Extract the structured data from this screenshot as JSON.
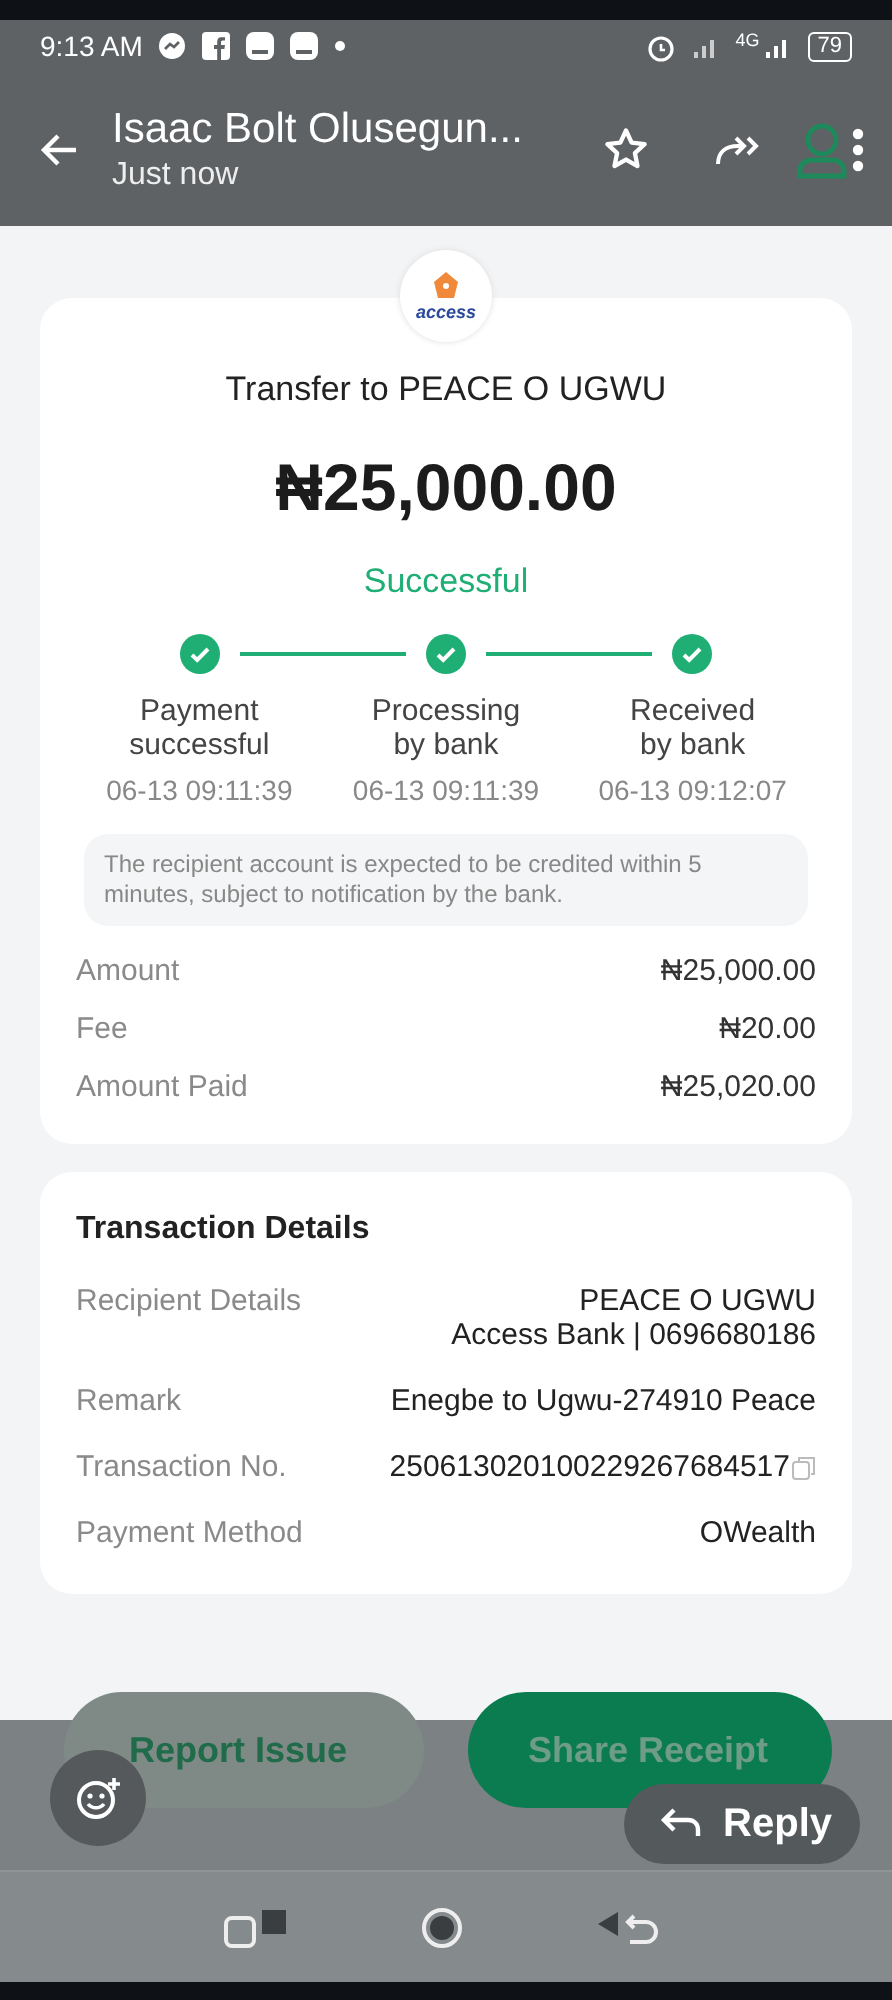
{
  "status_bar": {
    "time": "9:13 AM",
    "network": "4G",
    "battery": "79"
  },
  "header": {
    "title": "Isaac Bolt Olusegun...",
    "subtitle": "Just now"
  },
  "receipt": {
    "bank_logo_text": "access",
    "title": "Transfer to PEACE O UGWU",
    "amount": "₦25,000.00",
    "status": "Successful",
    "steps": [
      {
        "label": "Payment\nsuccessful",
        "time": "06-13 09:11:39",
        "done": true
      },
      {
        "label": "Processing\nby bank",
        "time": "06-13 09:11:39",
        "done": true
      },
      {
        "label": "Received\nby bank",
        "time": "06-13 09:12:07",
        "done": true
      }
    ],
    "note": "The recipient account is expected to be credited within 5 minutes, subject to notification by the bank.",
    "summary": [
      {
        "label": "Amount",
        "value": "₦25,000.00"
      },
      {
        "label": "Fee",
        "value": "₦20.00"
      },
      {
        "label": "Amount Paid",
        "value": "₦25,020.00"
      }
    ]
  },
  "details": {
    "title": "Transaction Details",
    "rows": [
      {
        "label": "Recipient Details",
        "lines": [
          "PEACE O UGWU",
          "Access Bank | 0696680186"
        ],
        "copyable": false
      },
      {
        "label": "Remark",
        "lines": [
          "Enegbe to Ugwu-274910 Peace"
        ],
        "copyable": false
      },
      {
        "label": "Transaction No.",
        "lines": [
          "250613020100229267684517"
        ],
        "copyable": true
      },
      {
        "label": "Payment Method",
        "lines": [
          "OWealth"
        ],
        "copyable": false
      }
    ]
  },
  "actions": [
    {
      "label": "Report Issue",
      "kind": "secondary"
    },
    {
      "label": "Share Receipt",
      "kind": "primary"
    }
  ],
  "reply": {
    "label": "Reply"
  }
}
